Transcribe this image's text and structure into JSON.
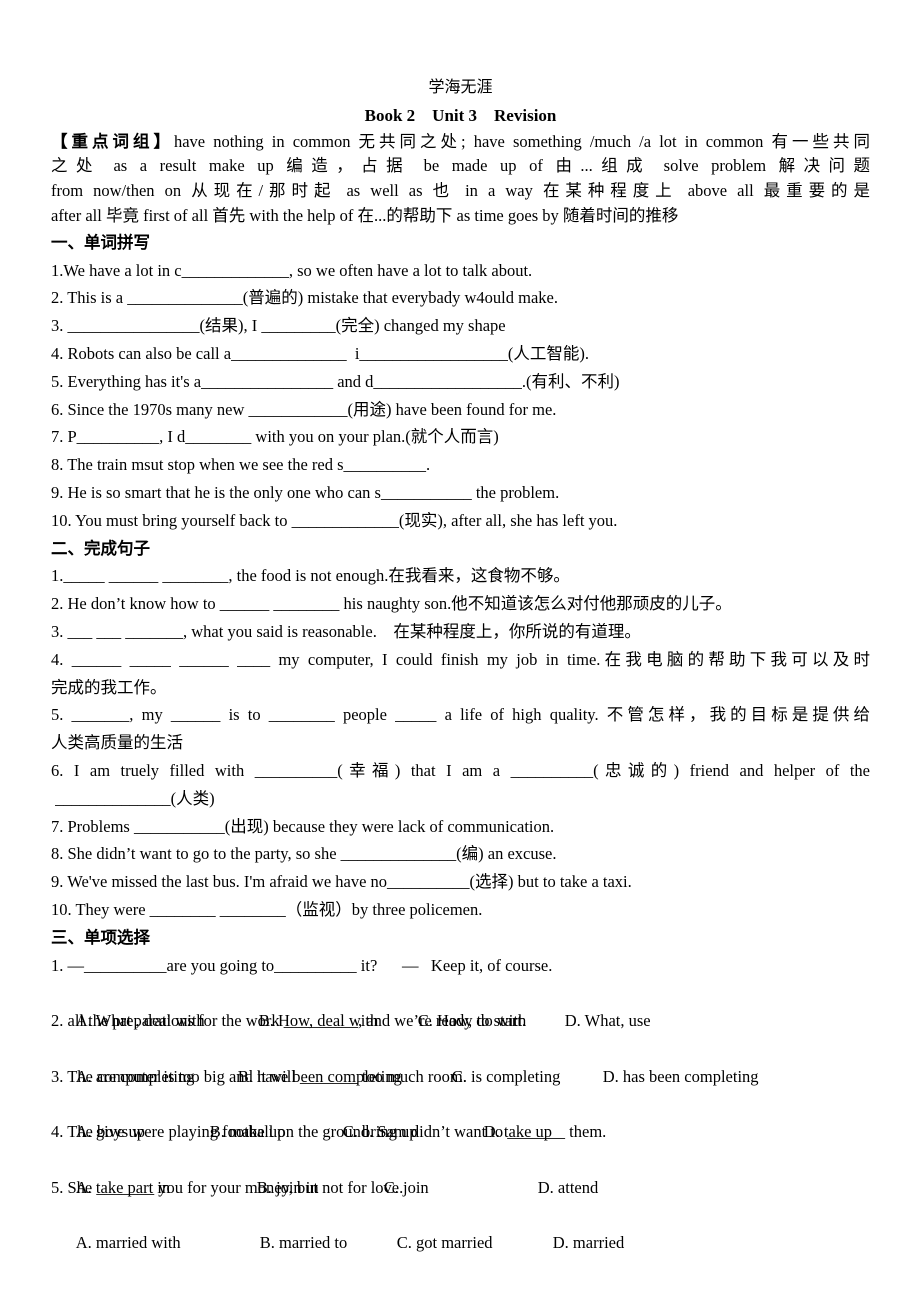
{
  "header": {
    "top_text": "学海无涯",
    "title": "Book 2    Unit 3    Revision"
  },
  "vocab": {
    "label": "【重点词组】",
    "lines": [
      "have nothing in common  无共同之处; have something /much /a lot in common  有一些共同",
      "之处      as a result      make up  编造，占据        be made up of  由...组成      solve problem  解决问题",
      "from now/then on  从现在/那时起      as well as  也      in a way  在某种程度上      above all  最重要的是",
      "after all  毕竟     first of all  首先      with the help of  在...的帮助下      as time goes by  随着时间的推移"
    ]
  },
  "section1": {
    "heading": "一、单词拼写",
    "items": [
      "1.We have a lot in c_____________, so we often have a lot to talk about.",
      "2. This is a ______________(普遍的) mistake that everybady w4ould make.",
      "3. ________________(结果), I _________(完全) changed my shape",
      "4. Robots can also be call a______________  i__________________(人工智能).",
      "5. Everything has it's a________________ and d__________________.(有利、不利)",
      "6. Since the 1970s many new ____________(用途) have been found for me.",
      "7. P__________, I d________ with you on your plan.(就个人而言)",
      "8. The train msut stop when we see the red s__________.",
      "9. He is so smart that he is the only one who can s___________ the problem.",
      "10. You must bring yourself back to _____________(现实), after all, she has left you."
    ]
  },
  "section2": {
    "heading": "二、完成句子",
    "items": [
      {
        "line1": "1._____ ______ ________, the food is not enough.在我看来，这食物不够。"
      },
      {
        "line1": "2. He don’t know how to ______ ________ his naughty son.他不知道该怎么对付他那顽皮的儿子。"
      },
      {
        "line1": "3. ___ ___ _______, what you said is reasonable.    在某种程度上，你所说的有道理。"
      },
      {
        "line1": "4. ______ _____ ______ ____ my computer, I could finish my job in time.在我电脑的帮助下我可以及时",
        "line2": "完成的我工作。"
      },
      {
        "line1": "5. _______, my ______ is to ________ people _____ a life of high quality.  不管怎样，我的目标是提供给",
        "line2": "人类高质量的生活"
      },
      {
        "line1": "6. I am truely filled with __________(幸福) that I am a __________(忠诚的) friend and helper of the",
        "line2": " ______________(人类)"
      },
      {
        "line1": "7. Problems ___________(出现) because they were lack of communication."
      },
      {
        "line1": "8. She didn’t want to go to the party, so she ______________(编) an excuse."
      },
      {
        "line1": "9. We've missed the last bus. I'm afraid we have no__________(选择) but to take a taxi."
      },
      {
        "line1": "10. They were ________ ________（监视）by three policemen."
      }
    ]
  },
  "section3": {
    "heading": "三、单项选择",
    "questions": [
      {
        "stem": "1. —__________are you going to__________ it?      —   Keep it, of course.",
        "options": [
          "A. What , deal with",
          "B. How, deal with",
          "C. How, do with",
          "D. What, use"
        ]
      },
      {
        "stem": "2. all the preparations for the work _________, and we’re ready to start.",
        "options": [
          "A. are completing",
          "B. have been completing",
          "C. is completing",
          "D. has been completing"
        ]
      },
      {
        "stem": "3. The computer is too big and it will _______ too much room.",
        "options": [
          "A. give up",
          "B. make up",
          "C. bring up",
          "D. take up"
        ]
      },
      {
        "stem": "4. The boys were playing football on the ground. Sam didn’t want to _______ them.",
        "options": [
          "A. take part in",
          "B. join in",
          "C. join",
          "D. attend"
        ]
      },
      {
        "stem": "5. She _______ you for your money, but not for love.",
        "options": [
          "A. married with",
          "B. married to",
          "C. got married",
          "D. married"
        ]
      }
    ]
  }
}
